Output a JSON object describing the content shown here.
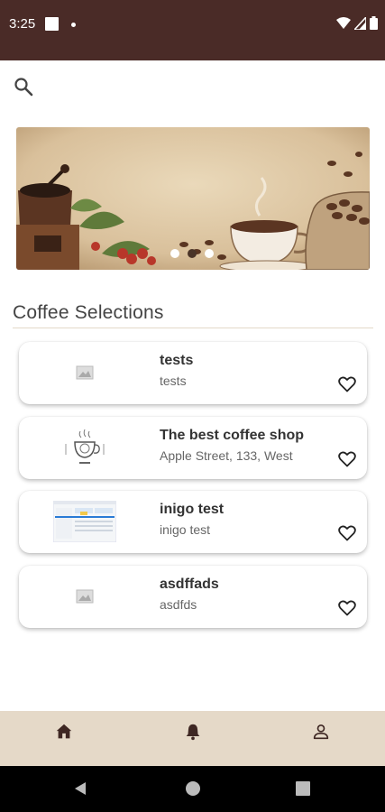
{
  "status_bar": {
    "time": "3:25"
  },
  "search": {
    "icon": "search-icon"
  },
  "banner": {
    "slides": 3,
    "active_slide": 1
  },
  "section": {
    "title": "Coffee Selections"
  },
  "shops": [
    {
      "title": "tests",
      "subtitle": "tests",
      "image": "image-placeholder-icon"
    },
    {
      "title": "The best coffee shop",
      "subtitle": "Apple Street, 133, West",
      "image": "coffee-cup-logo"
    },
    {
      "title": "inigo test",
      "subtitle": "inigo test",
      "image": "screenshot-thumbnail"
    },
    {
      "title": "asdffads",
      "subtitle": "asdfds",
      "image": "image-placeholder-icon"
    }
  ],
  "bottom_nav": {
    "items": [
      {
        "icon": "home-icon",
        "active": true
      },
      {
        "icon": "bell-icon",
        "active": false
      },
      {
        "icon": "person-icon",
        "active": false
      }
    ]
  },
  "colors": {
    "status_bar": "#4a2b27",
    "bottom_nav": "#e5d9c8",
    "accent": "#4a2b27"
  }
}
